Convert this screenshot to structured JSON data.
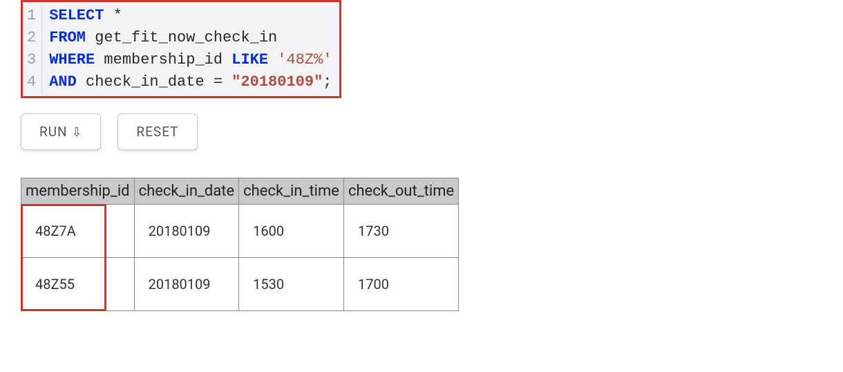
{
  "editor": {
    "lines": [
      {
        "n": "1",
        "tokens": [
          {
            "t": "SELECT",
            "c": "kw"
          },
          {
            "t": " *",
            "c": "plain"
          }
        ]
      },
      {
        "n": "2",
        "tokens": [
          {
            "t": "FROM",
            "c": "kw"
          },
          {
            "t": " get_fit_now_check_in",
            "c": "plain"
          }
        ]
      },
      {
        "n": "3",
        "tokens": [
          {
            "t": "WHERE",
            "c": "kw"
          },
          {
            "t": " membership_id ",
            "c": "plain"
          },
          {
            "t": "LIKE",
            "c": "kw"
          },
          {
            "t": " ",
            "c": "plain"
          },
          {
            "t": "'48Z%'",
            "c": "str1"
          }
        ]
      },
      {
        "n": "4",
        "tokens": [
          {
            "t": "AND",
            "c": "kw"
          },
          {
            "t": " check_in_date = ",
            "c": "plain"
          },
          {
            "t": "\"20180109\"",
            "c": "str2"
          },
          {
            "t": ";",
            "c": "plain"
          }
        ]
      }
    ]
  },
  "buttons": {
    "run": "RUN",
    "run_arrow": "⇩",
    "reset": "RESET"
  },
  "table": {
    "headers": [
      "membership_id",
      "check_in_date",
      "check_in_time",
      "check_out_time"
    ],
    "rows": [
      [
        "48Z7A",
        "20180109",
        "1600",
        "1730"
      ],
      [
        "48Z55",
        "20180109",
        "1530",
        "1700"
      ]
    ]
  }
}
